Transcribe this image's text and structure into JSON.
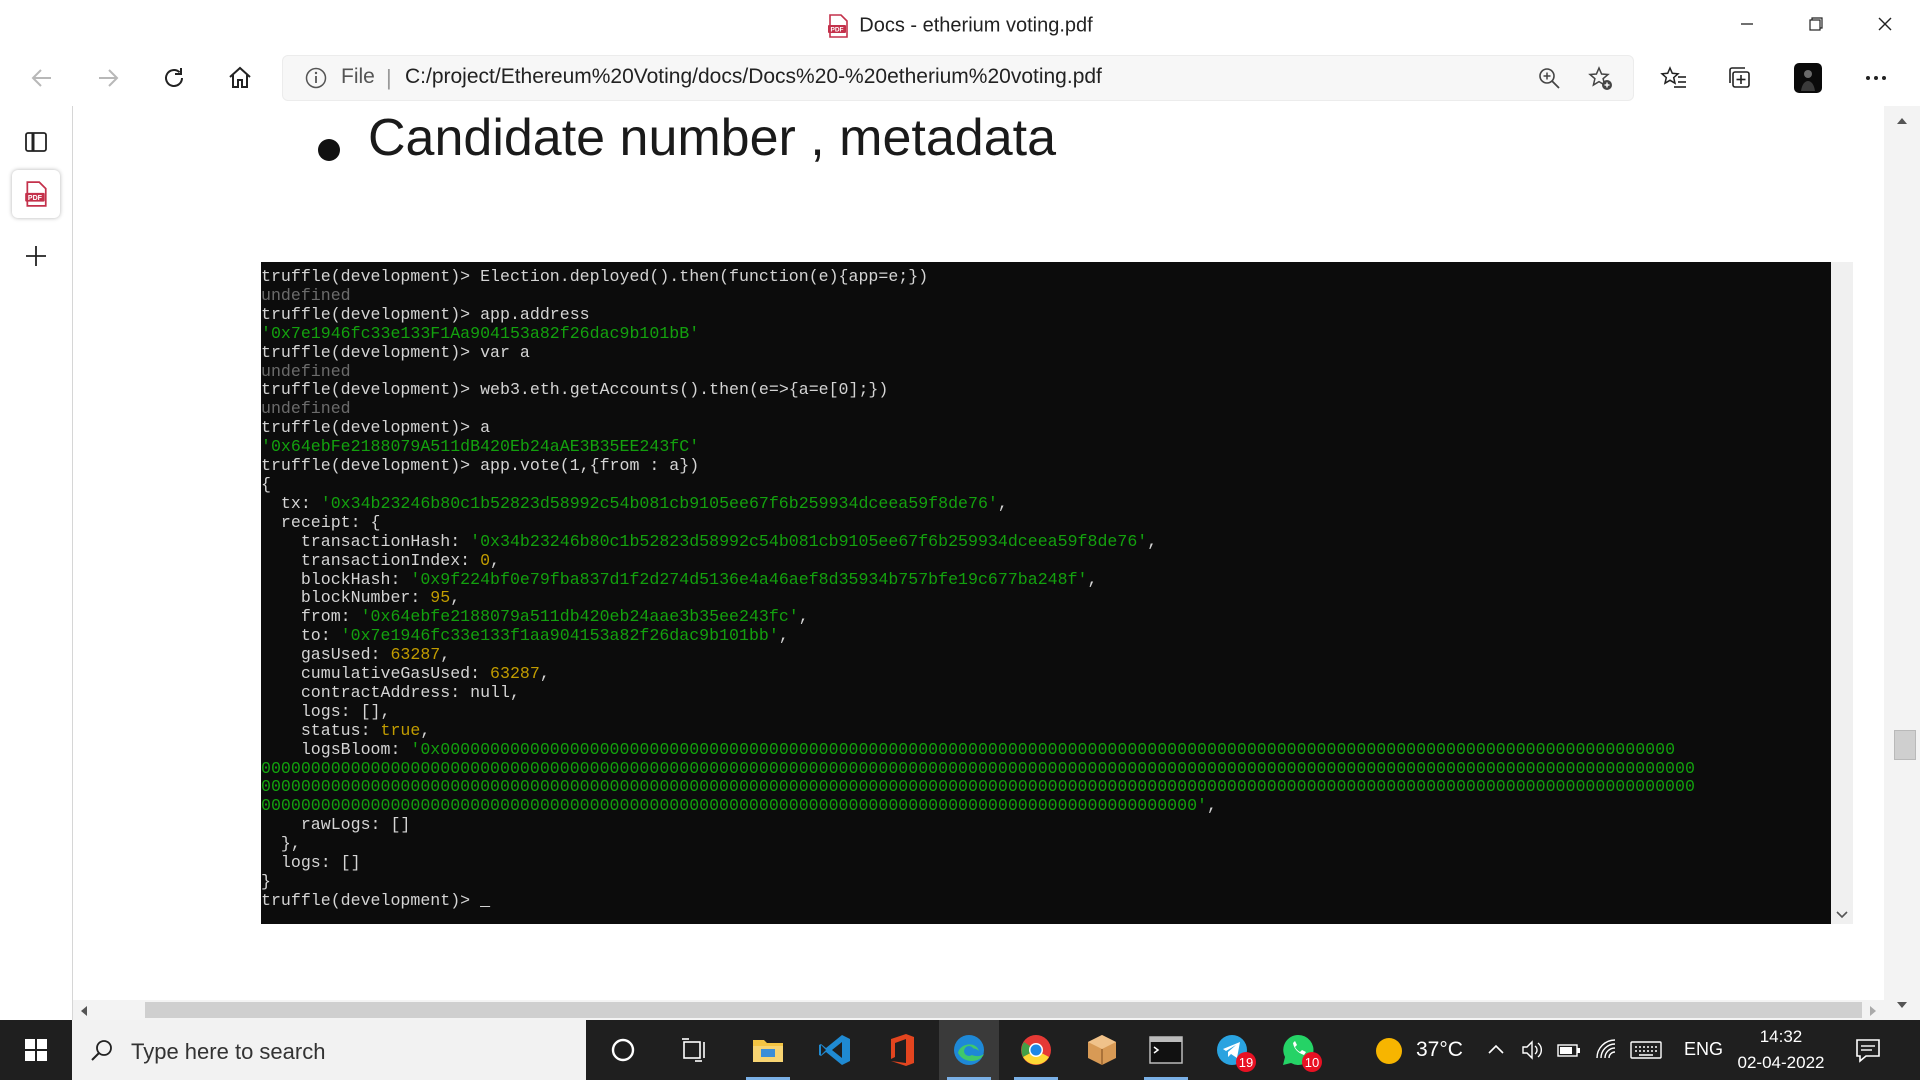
{
  "window": {
    "title": "Docs - etherium voting.pdf",
    "controls": [
      "minimize",
      "restore",
      "close"
    ]
  },
  "toolbar": {
    "address_prefix": "File",
    "separator": "|",
    "url": "C:/project/Ethereum%20Voting/docs/Docs%20-%20etherium%20voting.pdf"
  },
  "document": {
    "heading": "Candidate number , metadata"
  },
  "terminal": {
    "prompt": "truffle(development)> ",
    "cursor": "_"
  },
  "taskbar": {
    "search_placeholder": "Type here to search",
    "telegram_badge": "19",
    "whatsapp_badge": "10",
    "temperature": "37°C",
    "language": "ENG",
    "time": "14:32",
    "date": "02-04-2022"
  },
  "colors": {
    "terminal_bg": "#0c0c0c",
    "string_green": "#13a10e",
    "number_yellow": "#c19c00",
    "muted_gray": "#6b6b6b",
    "taskbar_bg": "#1f1f1f"
  }
}
